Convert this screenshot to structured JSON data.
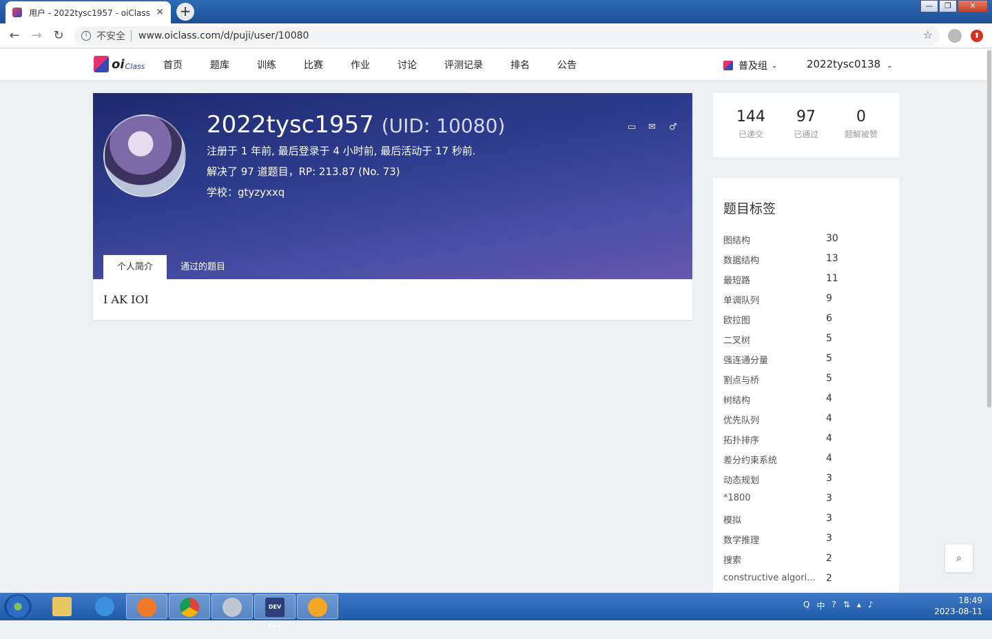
{
  "browser": {
    "tab_title": "用户 - 2022tysc1957 - oiClass",
    "tab_close": "✕",
    "new_tab": "+",
    "insecure_label": "不安全",
    "url": "www.oiclass.com/d/puji/user/10080",
    "window_buttons": {
      "minimize": "—",
      "maximize": "❐",
      "close": "✕"
    }
  },
  "site": {
    "logo_oi": "oi",
    "logo_class": "Class",
    "nav": [
      "首页",
      "题库",
      "训练",
      "比赛",
      "作业",
      "讨论",
      "评测记录",
      "排名",
      "公告"
    ],
    "group": "普及组",
    "current_user": "2022tysc0138"
  },
  "profile": {
    "username": "2022tysc1957",
    "uid": "(UID: 10080)",
    "line1": "注册于 1 年前, 最后登录于 4 小时前, 最后活动于 17 秒前.",
    "line2": "解决了 97 道题目，RP: 213.87 (No. 73)",
    "line3": "学校：gtyzyxxq",
    "tabs": [
      "个人简介",
      "通过的题目"
    ],
    "bio": "I AK IOI"
  },
  "stats": [
    {
      "value": "144",
      "label": "已递交"
    },
    {
      "value": "97",
      "label": "已通过"
    },
    {
      "value": "0",
      "label": "题解被赞"
    }
  ],
  "tags": {
    "title": "题目标签",
    "items": [
      {
        "name": "图结构",
        "count": "30"
      },
      {
        "name": "数据结构",
        "count": "13"
      },
      {
        "name": "最短路",
        "count": "11"
      },
      {
        "name": "单调队列",
        "count": "9"
      },
      {
        "name": "欧拉图",
        "count": "6"
      },
      {
        "name": "二叉树",
        "count": "5"
      },
      {
        "name": "强连通分量",
        "count": "5"
      },
      {
        "name": "割点与桥",
        "count": "5"
      },
      {
        "name": "树结构",
        "count": "4"
      },
      {
        "name": "优先队列",
        "count": "4"
      },
      {
        "name": "拓扑排序",
        "count": "4"
      },
      {
        "name": "差分约束系统",
        "count": "4"
      },
      {
        "name": "动态规划",
        "count": "3"
      },
      {
        "name": "*1800",
        "count": "3"
      },
      {
        "name": "模拟",
        "count": "3"
      },
      {
        "name": "数学推理",
        "count": "3"
      },
      {
        "name": "搜索",
        "count": "2"
      },
      {
        "name": "constructive algori...",
        "count": "2"
      }
    ]
  },
  "taskbar": {
    "time": "18:49",
    "date": "2023-08-11",
    "ime": "中",
    "dev_label": "DEV C++"
  }
}
